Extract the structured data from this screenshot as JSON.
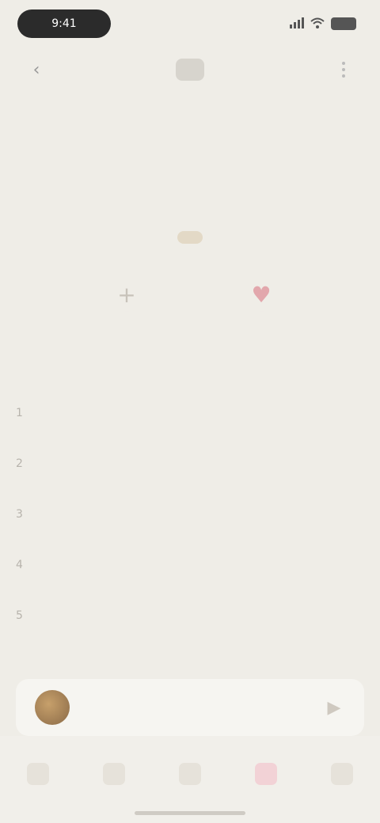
{
  "status": {
    "time": "9:41",
    "battery": "",
    "signal": "",
    "wifi": ""
  },
  "nav": {
    "back_icon": "chevron-left-icon",
    "center_icon": "cloud-icon",
    "more_icon": "more-vertical-icon"
  },
  "header": {
    "title": "",
    "subtitle": ""
  },
  "tabs": [
    {
      "label": "",
      "active": false
    },
    {
      "label": "",
      "active": true
    },
    {
      "label": "",
      "active": false
    }
  ],
  "actions": [
    {
      "icon": "plus-icon",
      "label": ""
    },
    {
      "icon": "heart-icon",
      "label": ""
    }
  ],
  "page_indicator": "",
  "tracks": [
    {
      "index": "1",
      "title": ""
    },
    {
      "index": "2",
      "title": ""
    },
    {
      "index": "3",
      "title": ""
    },
    {
      "index": "4",
      "title": ""
    },
    {
      "index": "5",
      "title": ""
    }
  ],
  "mini_player": {
    "title": "",
    "artist": "",
    "play_icon": "play-icon"
  },
  "bottom_nav": [
    {
      "icon": "home-icon",
      "label": "",
      "active": false
    },
    {
      "icon": "library-icon",
      "label": "",
      "active": false
    },
    {
      "icon": "search-icon",
      "label": "",
      "active": false
    },
    {
      "icon": "heart-icon",
      "label": "",
      "active": true
    },
    {
      "icon": "profile-icon",
      "label": "",
      "active": false
    }
  ],
  "colors": {
    "background": "#efede7",
    "accent_gold": "#a68f65",
    "accent_pink": "#e2a7ac"
  }
}
